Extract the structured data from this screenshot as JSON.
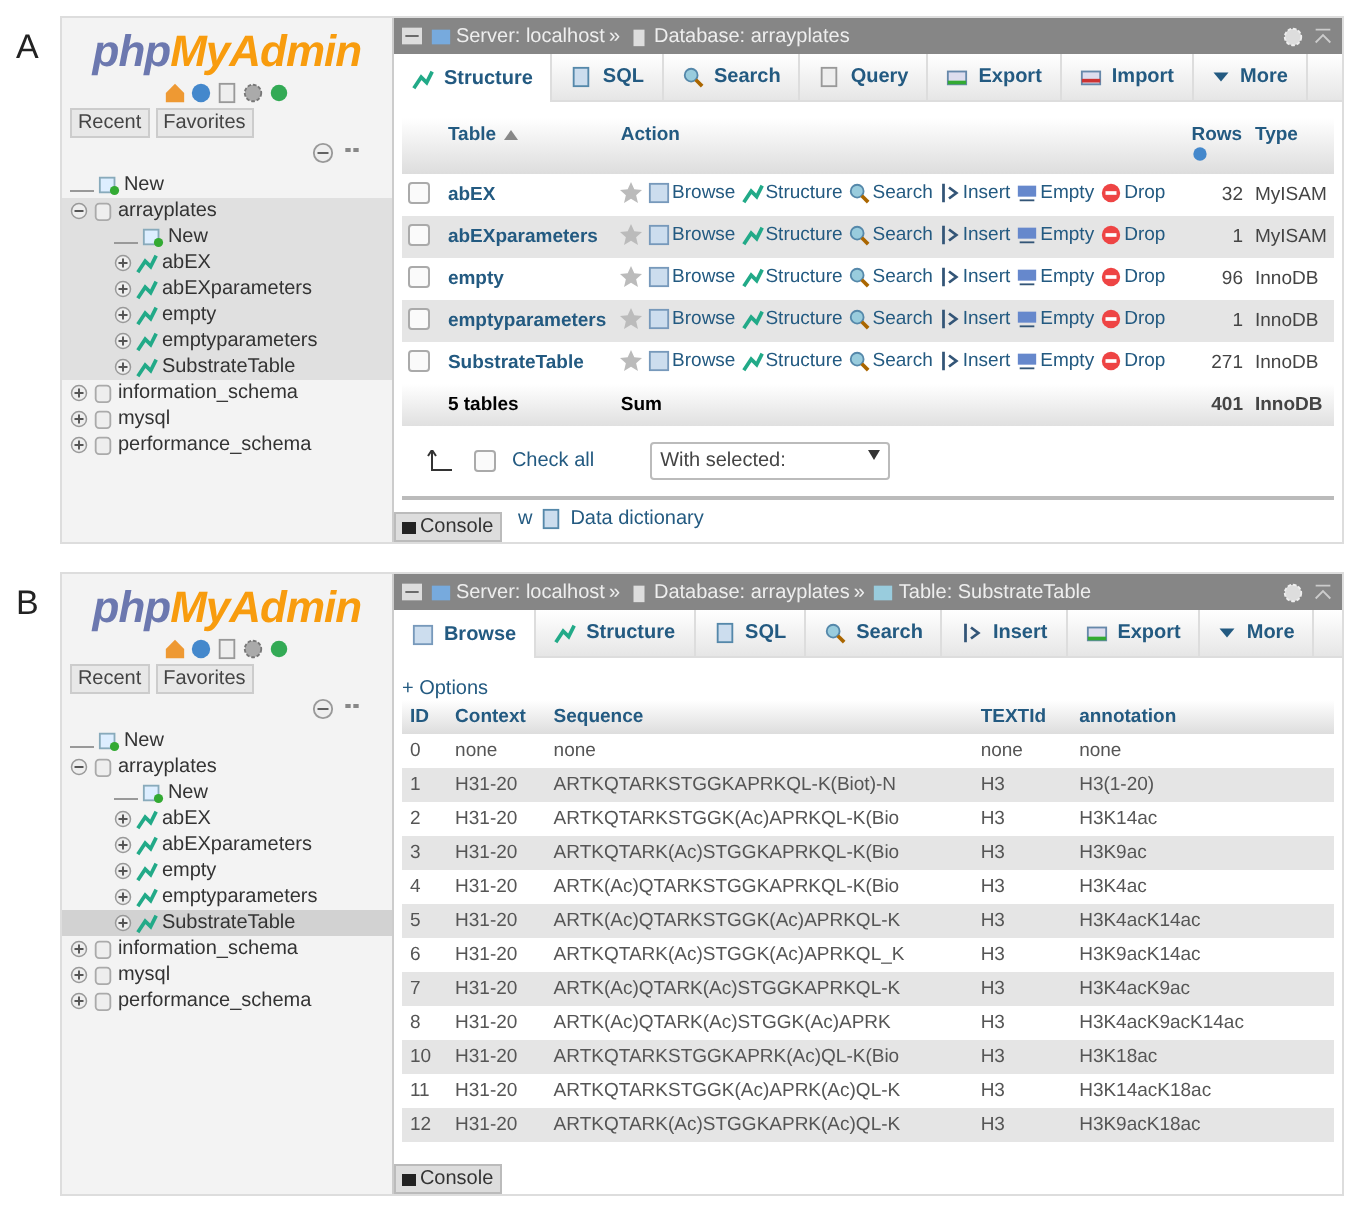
{
  "panels": [
    {
      "label": "A",
      "sidebar": {
        "logo": {
          "part1": "php",
          "part2": "MyAdmin"
        },
        "nav_buttons": [
          "Recent",
          "Favorites"
        ],
        "tree": [
          {
            "label": "New",
            "kind": "new"
          },
          {
            "label": "arrayplates",
            "kind": "database",
            "expanded": true,
            "selected": true,
            "children": [
              {
                "label": "New",
                "kind": "new"
              },
              {
                "label": "abEX",
                "kind": "table",
                "expanded": false,
                "selected": false
              },
              {
                "label": "abEXparameters",
                "kind": "table",
                "expanded": false,
                "selected": false
              },
              {
                "label": "empty",
                "kind": "table",
                "expanded": false,
                "selected": false
              },
              {
                "label": "emptyparameters",
                "kind": "table",
                "expanded": false,
                "selected": false
              },
              {
                "label": "SubstrateTable",
                "kind": "table",
                "expanded": false,
                "selected": false
              }
            ]
          },
          {
            "label": "information_schema",
            "kind": "database",
            "expanded": false,
            "selected": false
          },
          {
            "label": "mysql",
            "kind": "database",
            "expanded": false,
            "selected": false
          },
          {
            "label": "performance_schema",
            "kind": "database",
            "expanded": false,
            "selected": false
          }
        ]
      },
      "breadcrumb": [
        {
          "kind": "server",
          "text": "Server: localhost",
          "separator": "»"
        },
        {
          "kind": "database",
          "text": "Database: arrayplates"
        }
      ],
      "tabs": [
        {
          "label": "Structure",
          "kind": "structure",
          "selected": true
        },
        {
          "label": "SQL",
          "kind": "sql",
          "selected": false
        },
        {
          "label": "Search",
          "kind": "search",
          "selected": false
        },
        {
          "label": "Query",
          "kind": "query",
          "selected": false
        },
        {
          "label": "Export",
          "kind": "export",
          "selected": false
        },
        {
          "label": "Import",
          "kind": "import",
          "selected": false
        },
        {
          "label": "More",
          "kind": "more",
          "selected": false
        }
      ],
      "content": {
        "kind": "structure",
        "columns": [
          {
            "label": "Table",
            "sorted": true
          },
          {
            "label": "Action",
            "sorted": false
          },
          {
            "label": "Rows",
            "sorted": false,
            "info": true
          },
          {
            "label": "Type",
            "sorted": false
          }
        ],
        "rows": [
          {
            "name": "abEX",
            "checked": false,
            "actions": [
              "Browse",
              "Structure",
              "Search",
              "Insert",
              "Empty",
              "Drop"
            ],
            "rows": "32",
            "type": "MyISAM"
          },
          {
            "name": "abEXparameters",
            "checked": false,
            "actions": [
              "Browse",
              "Structure",
              "Search",
              "Insert",
              "Empty",
              "Drop"
            ],
            "rows": "1",
            "type": "MyISAM"
          },
          {
            "name": "empty",
            "checked": false,
            "actions": [
              "Browse",
              "Structure",
              "Search",
              "Insert",
              "Empty",
              "Drop"
            ],
            "rows": "96",
            "type": "InnoDB"
          },
          {
            "name": "emptyparameters",
            "checked": false,
            "actions": [
              "Browse",
              "Structure",
              "Search",
              "Insert",
              "Empty",
              "Drop"
            ],
            "rows": "1",
            "type": "InnoDB"
          },
          {
            "name": "SubstrateTable",
            "checked": false,
            "actions": [
              "Browse",
              "Structure",
              "Search",
              "Insert",
              "Empty",
              "Drop"
            ],
            "rows": "271",
            "type": "InnoDB"
          }
        ],
        "summary": {
          "tables": "5 tables",
          "action": "Sum",
          "rows": "401",
          "type": "InnoDB"
        },
        "check_all": "Check all",
        "check_all_checked": false,
        "with_selected": "With selected:",
        "links": [
          {
            "kind": "print",
            "text": "w"
          },
          {
            "kind": "dictionary",
            "text": "Data dictionary"
          }
        ]
      },
      "console": "Console"
    },
    {
      "label": "B",
      "sidebar": {
        "logo": {
          "part1": "php",
          "part2": "MyAdmin"
        },
        "nav_buttons": [
          "Recent",
          "Favorites"
        ],
        "tree": [
          {
            "label": "New",
            "kind": "new"
          },
          {
            "label": "arrayplates",
            "kind": "database",
            "expanded": true,
            "selected": false,
            "children": [
              {
                "label": "New",
                "kind": "new"
              },
              {
                "label": "abEX",
                "kind": "table",
                "expanded": false,
                "selected": false
              },
              {
                "label": "abEXparameters",
                "kind": "table",
                "expanded": false,
                "selected": false
              },
              {
                "label": "empty",
                "kind": "table",
                "expanded": false,
                "selected": false
              },
              {
                "label": "emptyparameters",
                "kind": "table",
                "expanded": false,
                "selected": false
              },
              {
                "label": "SubstrateTable",
                "kind": "table",
                "expanded": false,
                "selected": true
              }
            ]
          },
          {
            "label": "information_schema",
            "kind": "database",
            "expanded": false,
            "selected": false
          },
          {
            "label": "mysql",
            "kind": "database",
            "expanded": false,
            "selected": false
          },
          {
            "label": "performance_schema",
            "kind": "database",
            "expanded": false,
            "selected": false
          }
        ]
      },
      "breadcrumb": [
        {
          "kind": "server",
          "text": "Server: localhost",
          "separator": "»"
        },
        {
          "kind": "database",
          "text": "Database: arrayplates",
          "separator": "»"
        },
        {
          "kind": "table",
          "text": "Table: SubstrateTable"
        }
      ],
      "tabs": [
        {
          "label": "Browse",
          "kind": "browse",
          "selected": true
        },
        {
          "label": "Structure",
          "kind": "structure",
          "selected": false
        },
        {
          "label": "SQL",
          "kind": "sql",
          "selected": false
        },
        {
          "label": "Search",
          "kind": "search",
          "selected": false
        },
        {
          "label": "Insert",
          "kind": "insert",
          "selected": false
        },
        {
          "label": "Export",
          "kind": "export",
          "selected": false
        },
        {
          "label": "More",
          "kind": "more",
          "selected": false
        }
      ],
      "content": {
        "kind": "browse",
        "options": "+ Options",
        "columns": [
          "ID",
          "Context",
          "Sequence",
          "TEXTId",
          "annotation"
        ],
        "rows": [
          [
            "0",
            "none",
            "none",
            "none",
            "none"
          ],
          [
            "1",
            "H31-20",
            "ARTKQTARKSTGGKAPRKQL-K(Biot)-N",
            "H3",
            "H3(1-20)"
          ],
          [
            "2",
            "H31-20",
            "ARTKQTARKSTGGK(Ac)APRKQL-K(Bio",
            "H3",
            "H3K14ac"
          ],
          [
            "3",
            "H31-20",
            "ARTKQTARK(Ac)STGGKAPRKQL-K(Bio",
            "H3",
            "H3K9ac"
          ],
          [
            "4",
            "H31-20",
            "ARTK(Ac)QTARKSTGGKAPRKQL-K(Bio",
            "H3",
            "H3K4ac"
          ],
          [
            "5",
            "H31-20",
            "ARTK(Ac)QTARKSTGGK(Ac)APRKQL-K",
            "H3",
            "H3K4acK14ac"
          ],
          [
            "6",
            "H31-20",
            "ARTKQTARK(Ac)STGGK(Ac)APRKQL_K",
            "H3",
            "H3K9acK14ac"
          ],
          [
            "7",
            "H31-20",
            "ARTK(Ac)QTARK(Ac)STGGKAPRKQL-K",
            "H3",
            "H3K4acK9ac"
          ],
          [
            "8",
            "H31-20",
            "ARTK(Ac)QTARK(Ac)STGGK(Ac)APRK",
            "H3",
            "H3K4acK9acK14ac"
          ],
          [
            "10",
            "H31-20",
            "ARTKQTARKSTGGKAPRK(Ac)QL-K(Bio",
            "H3",
            "H3K18ac"
          ],
          [
            "11",
            "H31-20",
            "ARTKQTARKSTGGK(Ac)APRK(Ac)QL-K",
            "H3",
            "H3K14acK18ac"
          ],
          [
            "12",
            "H31-20",
            "ARTKQTARK(Ac)STGGKAPRK(Ac)QL-K",
            "H3",
            "H3K9acK18ac"
          ]
        ]
      },
      "console": "Console"
    }
  ]
}
